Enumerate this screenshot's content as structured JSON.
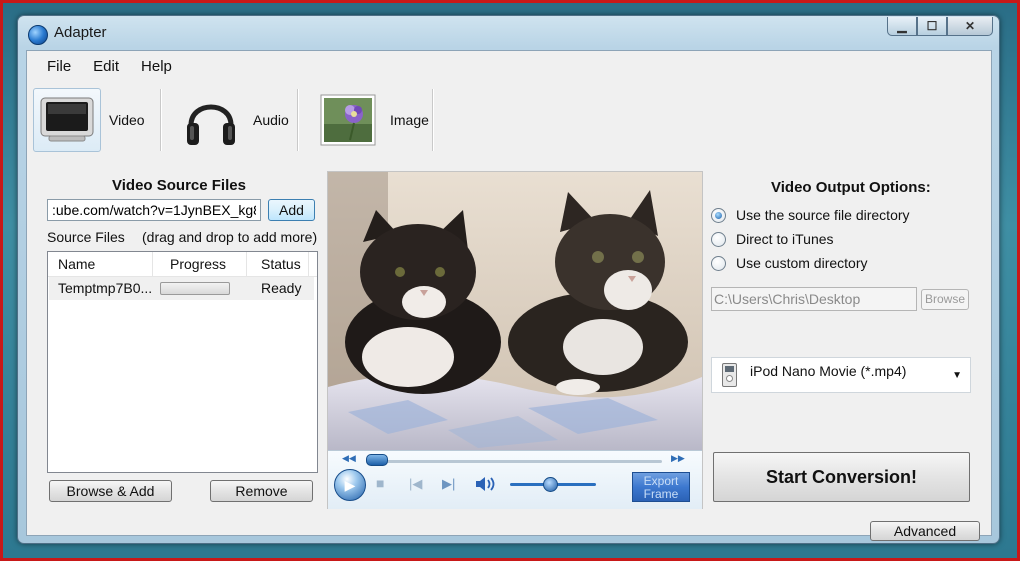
{
  "window": {
    "title": "Adapter",
    "controls": [
      "▁",
      "☐",
      "✕"
    ]
  },
  "menu": [
    "File",
    "Edit",
    "Help"
  ],
  "modes": [
    {
      "label": "Video",
      "icon": "monitor-icon",
      "selected": true
    },
    {
      "label": "Audio",
      "icon": "headphones-icon",
      "selected": false
    },
    {
      "label": "Image",
      "icon": "flower-photo-icon",
      "selected": false
    }
  ],
  "source": {
    "title": "Video Source Files",
    "url_value": ":ube.com/watch?v=1JynBEX_kg8",
    "add_label": "Add",
    "files_label": "Source Files",
    "drag_hint": "(drag and drop to add more)",
    "columns": [
      "Name",
      "Progress",
      "Status"
    ],
    "rows": [
      {
        "name": "Temptmp7B0...",
        "progress": 0,
        "status": "Ready"
      }
    ],
    "browse_add_label": "Browse & Add",
    "remove_label": "Remove"
  },
  "player": {
    "seek_position": 0,
    "volume": 0.45,
    "export_label_1": "Export",
    "export_label_2": "Frame"
  },
  "output": {
    "title": "Video Output Options:",
    "options": [
      {
        "label": "Use the source file directory",
        "selected": true
      },
      {
        "label": "Direct to iTunes",
        "selected": false
      },
      {
        "label": "Use custom directory",
        "selected": false
      }
    ],
    "directory": "C:\\Users\\Chris\\Desktop",
    "browse_label": "Browse",
    "format": "iPod Nano Movie (*.mp4)",
    "start_label": "Start Conversion!",
    "advanced_label": "Advanced"
  },
  "colors": {
    "frame_red": "#c81818",
    "accent_blue": "#2b62b6",
    "progress_green": "#3fb23f"
  }
}
